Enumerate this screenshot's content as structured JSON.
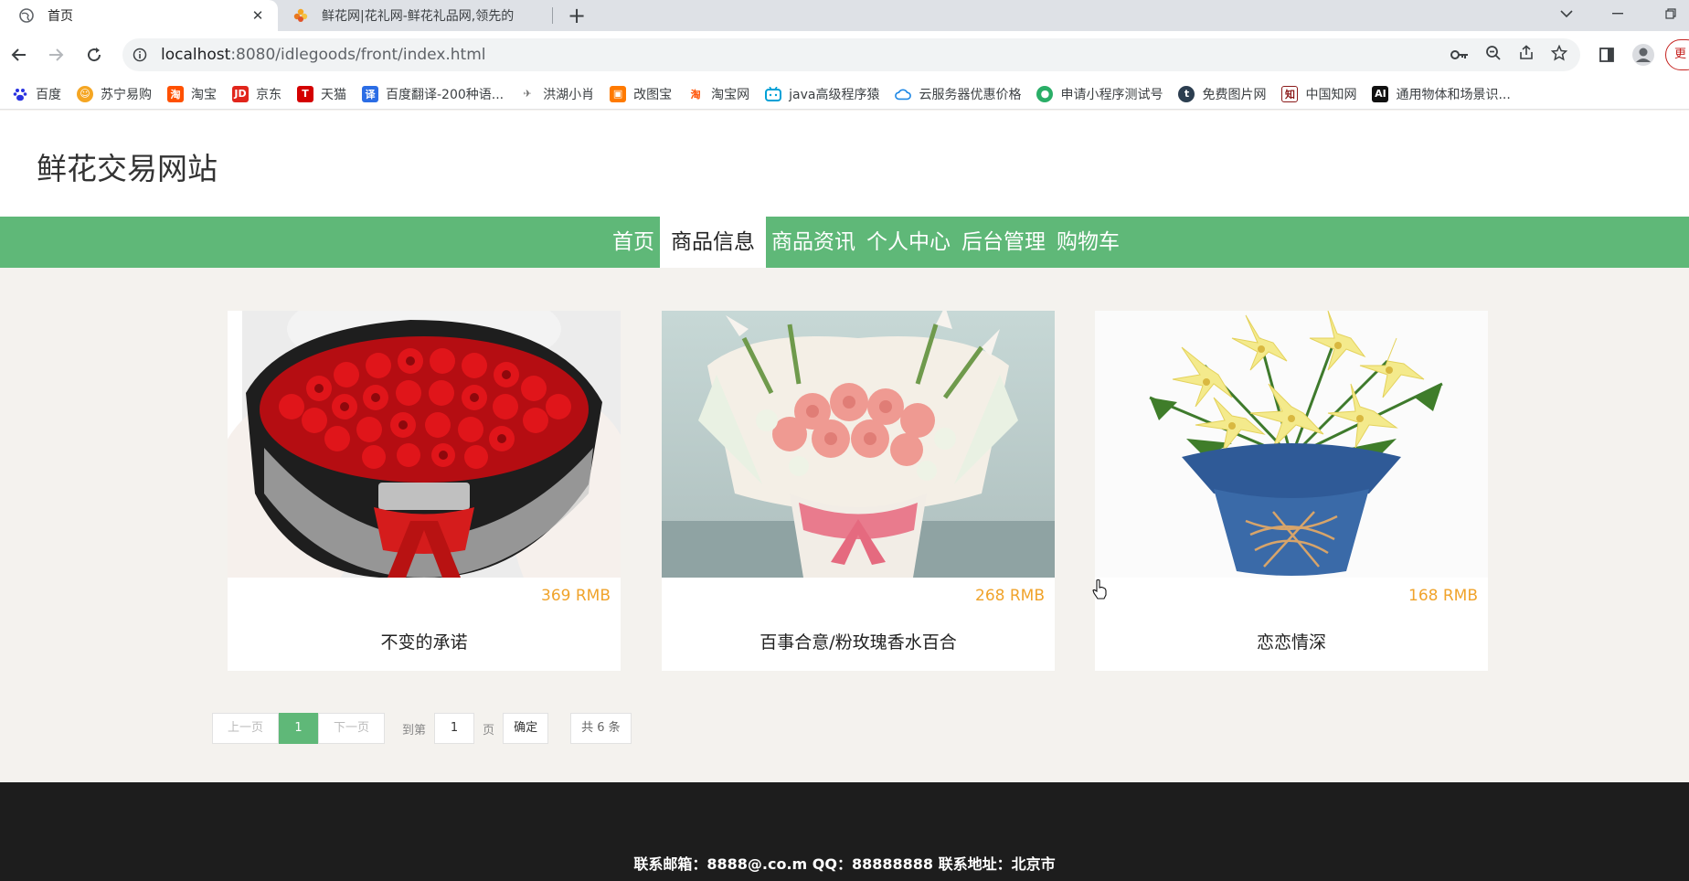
{
  "browser": {
    "tabs": [
      {
        "title": "首页",
        "active": true
      },
      {
        "title": "鲜花网|花礼网-鲜花礼品网,领先的",
        "active": false
      }
    ],
    "url_host": "localhost",
    "url_path": ":8080/idlegoods/front/index.html",
    "profile_label": "更",
    "bookmarks": [
      {
        "label": "百度",
        "icon": "baidu-paw-icon",
        "color": "#2932e1"
      },
      {
        "label": "苏宁易购",
        "icon": "suning-lion-icon",
        "color": "#f5a623"
      },
      {
        "label": "淘宝",
        "icon": "taobao-icon",
        "color": "#ff5000"
      },
      {
        "label": "京东",
        "icon": "jd-icon",
        "color": "#e1251b"
      },
      {
        "label": "天猫",
        "icon": "tmall-icon",
        "color": "#d40000"
      },
      {
        "label": "百度翻译-200种语...",
        "icon": "baidu-translate-icon",
        "color": "#2b6de5"
      },
      {
        "label": "洪湖小肖",
        "icon": "bird-icon",
        "color": "#6a6a6a"
      },
      {
        "label": "改图宝",
        "icon": "gaitubao-icon",
        "color": "#ff7a00"
      },
      {
        "label": "淘宝网",
        "icon": "taobao-icon",
        "color": "#ff5000"
      },
      {
        "label": "java高级程序猿",
        "icon": "bilibili-icon",
        "color": "#00a1d6"
      },
      {
        "label": "云服务器优惠价格",
        "icon": "cloud-icon",
        "color": "#1e88e5"
      },
      {
        "label": "申请小程序测试号",
        "icon": "wechat-icon",
        "color": "#2aae67"
      },
      {
        "label": "免费图片网",
        "icon": "t-icon",
        "color": "#2c3e50"
      },
      {
        "label": "中国知网",
        "icon": "cnki-icon",
        "color": "#8b1a1a"
      },
      {
        "label": "通用物体和场景识...",
        "icon": "ai-icon",
        "color": "#111111"
      }
    ]
  },
  "site": {
    "title": "鲜花交易网站",
    "nav": [
      {
        "label": "首页",
        "active": false
      },
      {
        "label": "商品信息",
        "active": true
      },
      {
        "label": "商品资讯",
        "active": false
      },
      {
        "label": "个人中心",
        "active": false
      },
      {
        "label": "后台管理",
        "active": false
      },
      {
        "label": "购物车",
        "active": false
      }
    ]
  },
  "products": [
    {
      "name": "不变的承诺",
      "price": "369 RMB"
    },
    {
      "name": "百事合意/粉玫瑰香水百合",
      "price": "268 RMB"
    },
    {
      "name": "恋恋情深",
      "price": "168 RMB"
    }
  ],
  "pagination": {
    "prev": "上一页",
    "current": "1",
    "next": "下一页",
    "goto_label": "到第",
    "goto_value": "1",
    "page_unit": "页",
    "confirm": "确定",
    "total": "共 6 条"
  },
  "footer": {
    "text": "联系邮箱：8888@.co.m QQ：88888888 联系地址：北京市"
  },
  "colors": {
    "nav_green": "#5fb878",
    "price_orange": "#f0a32b",
    "footer_bg": "#1d1d1d"
  }
}
